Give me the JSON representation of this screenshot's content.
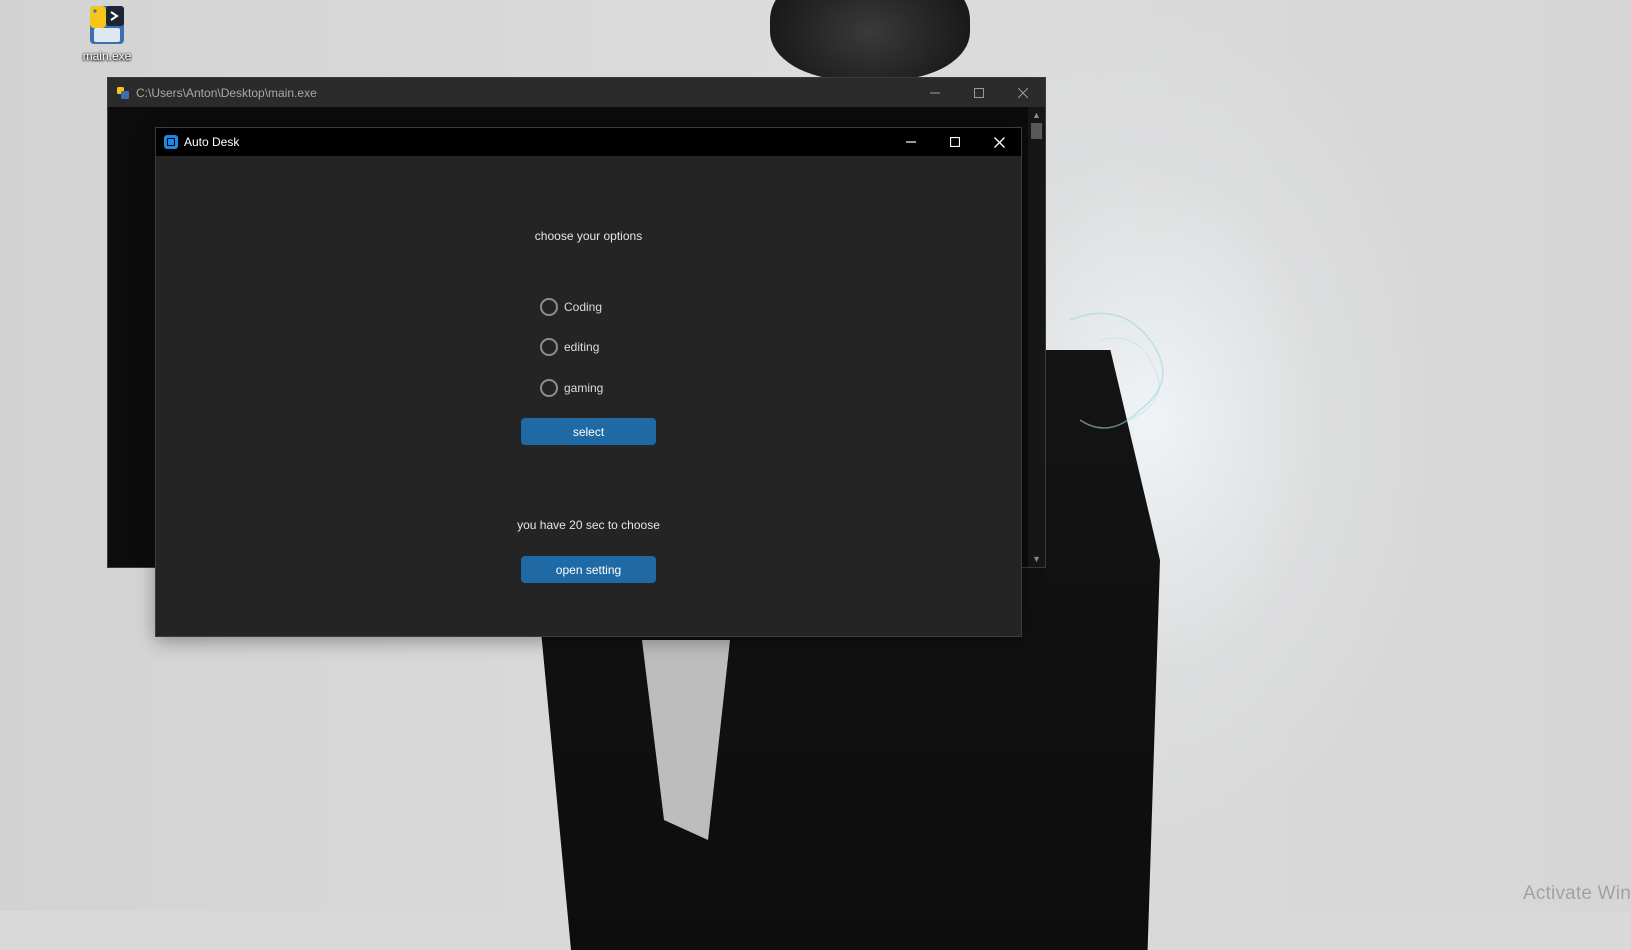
{
  "desktop": {
    "icon_label": "main.exe",
    "watermark": "Activate Win"
  },
  "console_window": {
    "title": "C:\\Users\\Anton\\Desktop\\main.exe"
  },
  "app_window": {
    "title": "Auto Desk",
    "heading": "choose your options",
    "options": [
      {
        "label": "Coding"
      },
      {
        "label": "editing"
      },
      {
        "label": "gaming"
      }
    ],
    "select_label": "select",
    "timer_text": "you have 20 sec to choose",
    "open_setting_label": "open setting",
    "accent_color": "#1f6aa5"
  }
}
